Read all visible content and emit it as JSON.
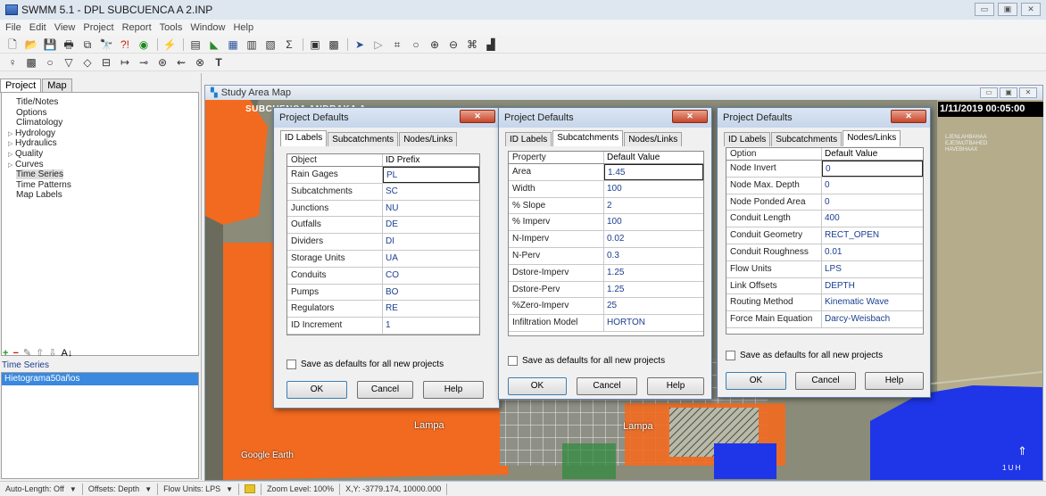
{
  "window": {
    "title": "SWMM 5.1 - DPL SUBCUENCA A 2.INP",
    "controls": [
      "▭",
      "▣",
      "✕"
    ]
  },
  "menu": [
    "File",
    "Edit",
    "View",
    "Project",
    "Report",
    "Tools",
    "Window",
    "Help"
  ],
  "toolbar1": [
    "new-icon",
    "open-icon",
    "save-icon",
    "print-icon",
    "copy-icon",
    "find-icon",
    "query-icon",
    "animate-icon",
    "run-icon",
    "table-icon",
    "profile-icon",
    "graph-icon",
    "statistics-icon",
    "summary-icon",
    "options-icon",
    "arrange-icon",
    "select-icon",
    "vertex-icon",
    "region-icon",
    "pan-icon",
    "zoom-in-icon",
    "zoom-out-icon",
    "full-extent-icon",
    "measure-icon"
  ],
  "toolbar2": [
    "rain-gage-icon",
    "subcatchment-icon",
    "junction-icon",
    "outfall-icon",
    "divider-icon",
    "storage-icon",
    "conduit-icon",
    "pump-icon",
    "orifice-icon",
    "weir-icon",
    "outlet-icon",
    "label-icon"
  ],
  "left_panel": {
    "tabs": [
      "Project",
      "Map"
    ],
    "tree": [
      {
        "label": "Title/Notes",
        "expandable": false
      },
      {
        "label": "Options",
        "expandable": false
      },
      {
        "label": "Climatology",
        "expandable": false
      },
      {
        "label": "Hydrology",
        "expandable": true
      },
      {
        "label": "Hydraulics",
        "expandable": true
      },
      {
        "label": "Quality",
        "expandable": true
      },
      {
        "label": "Curves",
        "expandable": true
      },
      {
        "label": "Time Series",
        "expandable": false,
        "selected": true
      },
      {
        "label": "Time Patterns",
        "expandable": false
      },
      {
        "label": "Map Labels",
        "expandable": false
      }
    ],
    "tools": {
      "add": "+",
      "delete": "−",
      "edit": "✎",
      "up": "⇧",
      "down": "⇩",
      "sort": "A↓"
    },
    "section_label": "Time Series",
    "items": [
      "Hietograma50años"
    ]
  },
  "map": {
    "title": "Study Area Map",
    "timestamp": "1/11/2019 00:05:00",
    "header_text": "SUBCUENCA ANDRAKA A",
    "places": [
      "Lampa",
      "Lampa"
    ],
    "watermark": "Google Earth",
    "right_note": "LJENLAHBAHAA EJESMJTBAHED HAVEBHAAX",
    "scale": "1 U H",
    "colors": {
      "subcatchment": "#f26a1f",
      "water": "#1f35e8",
      "terrain": "#8a8a72"
    }
  },
  "dialogs": [
    {
      "title": "Project Defaults",
      "tabs": [
        "ID Labels",
        "Subcatchments",
        "Nodes/Links"
      ],
      "active_tab": 0,
      "columns": [
        "Object",
        "ID Prefix"
      ],
      "rows": [
        [
          "Rain Gages",
          "PL"
        ],
        [
          "Subcatchments",
          "SC"
        ],
        [
          "Junctions",
          "NU"
        ],
        [
          "Outfalls",
          "DE"
        ],
        [
          "Dividers",
          "DI"
        ],
        [
          "Storage Units",
          "UA"
        ],
        [
          "Conduits",
          "CO"
        ],
        [
          "Pumps",
          "BO"
        ],
        [
          "Regulators",
          "RE"
        ],
        [
          "ID Increment",
          "1"
        ]
      ],
      "checkbox": "Save as defaults for all new projects",
      "buttons": [
        "OK",
        "Cancel",
        "Help"
      ]
    },
    {
      "title": "Project Defaults",
      "tabs": [
        "ID Labels",
        "Subcatchments",
        "Nodes/Links"
      ],
      "active_tab": 1,
      "columns": [
        "Property",
        "Default Value"
      ],
      "rows": [
        [
          "Area",
          "1.45"
        ],
        [
          "Width",
          "100"
        ],
        [
          "% Slope",
          "2"
        ],
        [
          "% Imperv",
          "100"
        ],
        [
          "N-Imperv",
          "0.02"
        ],
        [
          "N-Perv",
          "0.3"
        ],
        [
          "Dstore-Imperv",
          "1.25"
        ],
        [
          "Dstore-Perv",
          "1.25"
        ],
        [
          "%Zero-Imperv",
          "25"
        ],
        [
          "Infiltration Model",
          "HORTON"
        ]
      ],
      "checkbox": "Save as defaults for all new projects",
      "buttons": [
        "OK",
        "Cancel",
        "Help"
      ]
    },
    {
      "title": "Project Defaults",
      "tabs": [
        "ID Labels",
        "Subcatchments",
        "Nodes/Links"
      ],
      "active_tab": 2,
      "columns": [
        "Option",
        "Default Value"
      ],
      "rows": [
        [
          "Node Invert",
          "0"
        ],
        [
          "Node Max. Depth",
          "0"
        ],
        [
          "Node Ponded Area",
          "0"
        ],
        [
          "Conduit Length",
          "400"
        ],
        [
          "Conduit Geometry",
          "RECT_OPEN"
        ],
        [
          "Conduit Roughness",
          "0.01"
        ],
        [
          "Flow Units",
          "LPS"
        ],
        [
          "Link Offsets",
          "DEPTH"
        ],
        [
          "Routing Method",
          "Kinematic Wave"
        ],
        [
          "Force Main Equation",
          "Darcy-Weisbach"
        ]
      ],
      "checkbox": "Save as defaults for all new projects",
      "buttons": [
        "OK",
        "Cancel",
        "Help"
      ]
    }
  ],
  "status_bar": {
    "auto_length": "Auto-Length: Off",
    "offsets": "Offsets: Depth",
    "flow_units": "Flow Units: LPS",
    "zoom": "Zoom Level: 100%",
    "xy": "X,Y: -3779.174, 10000.000"
  }
}
